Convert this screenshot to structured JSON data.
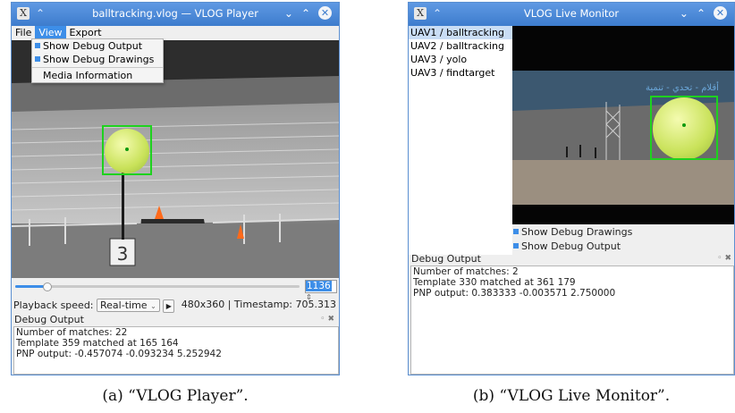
{
  "left_window": {
    "title": "balltracking.vlog — VLOG Player",
    "menu": [
      "File",
      "View",
      "Export"
    ],
    "view_menu": {
      "items": [
        {
          "label": "Show Debug Output",
          "checked": true
        },
        {
          "label": "Show Debug Drawings",
          "checked": true
        },
        {
          "label": "Media Information",
          "checked": false
        }
      ]
    },
    "frame_spin": "1136",
    "playback_label": "Playback speed:",
    "playback_value": "Real-time",
    "status": "480x360 | Timestamp: 705.313",
    "debug_title": "Debug Output",
    "debug_lines": [
      "Number of matches: 22",
      "Template 359 matched at 165 164",
      "PNP output: -0.457074 -0.093234 5.252942"
    ],
    "sign_number": "3",
    "slider_position": 0.11
  },
  "right_window": {
    "title": "VLOG Live Monitor",
    "streams": [
      "UAV1 / balltracking",
      "UAV2 / balltracking",
      "UAV3 / yolo",
      "UAV3 / findtarget"
    ],
    "selected_stream": 0,
    "checkboxes": [
      {
        "label": "Show Debug Drawings",
        "checked": true
      },
      {
        "label": "Show Debug Output",
        "checked": true
      }
    ],
    "debug_title": "Debug Output",
    "debug_lines": [
      "Number of matches: 2",
      "Template 330 matched at 361 179",
      "PNP output: 0.383333 -0.003571 2.750000"
    ],
    "banner_text": "أقلام - تحدي - تنمية"
  },
  "captions": {
    "left": "(a) “VLOG Player”.",
    "right": "(b) “VLOG Live Monitor”."
  },
  "colors": {
    "titlebar": "#4a88d6",
    "accent": "#3d8ee8",
    "bbox": "#1ed21e"
  },
  "icons": {
    "app": "x-app-icon",
    "shade": "shade-icon",
    "minimize": "chevron-down-icon",
    "maximize": "chevron-up-icon",
    "close": "close-icon",
    "spin": "spin-arrows-icon",
    "play": "play-icon",
    "combo": "combo-arrow-icon"
  }
}
